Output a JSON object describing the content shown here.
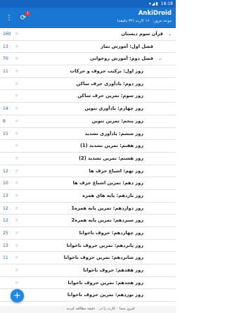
{
  "status": {
    "time": "18:18",
    "icons": "▾◢▮"
  },
  "appbar": {
    "title": "AnkiDroid",
    "subtitle": "موعد مرور: ۱۶۰ کارت (۳۲ دقیقه)",
    "sync_icon": "sync-icon",
    "sync_badge": "1",
    "more_icon": "more-vert-icon"
  },
  "decks": [
    {
      "name": "قرآن سوم دبستان",
      "count": "160",
      "count_color": "#1565c0",
      "level": 0,
      "expander": "⌄"
    },
    {
      "name": "فصل اول: آموزش نماز",
      "count": "13",
      "count_color": "#1565c0",
      "level": 1,
      "expander": ""
    },
    {
      "name": "فصل دوم: آموزش روخوانی",
      "count": "70",
      "count_color": "#1565c0",
      "level": 1,
      "expander": "⌄"
    },
    {
      "name": "روز اول: ترکیب حروف و حرکات",
      "count": "11",
      "count_color": "#1565c0",
      "level": 2,
      "expander": ""
    },
    {
      "name": "روز دوم: یادآوری حرف ساکن",
      "count": "",
      "count_color": "#1565c0",
      "level": 2,
      "expander": ""
    },
    {
      "name": "روز سوم: تمرین حرف ساکن",
      "count": "",
      "count_color": "#1565c0",
      "level": 2,
      "expander": ""
    },
    {
      "name": "روز چهارم: یادآوری تنوین",
      "count": "14",
      "count_color": "#1565c0",
      "level": 2,
      "expander": ""
    },
    {
      "name": "روز پنجم: تمرین تنوین",
      "count": "8",
      "count_color": "#1565c0",
      "level": 2,
      "expander": ""
    },
    {
      "name": "روز ششم: یادآوری تشدید",
      "count": "15",
      "count_color": "#1565c0",
      "level": 2,
      "expander": ""
    },
    {
      "name": "روز هفتم: تمرین تشدید (1)",
      "count": "",
      "count_color": "#1565c0",
      "level": 2,
      "expander": ""
    },
    {
      "name": "روز هشتم: تمرین تشدید (2)",
      "count": "",
      "count_color": "#1565c0",
      "level": 2,
      "expander": ""
    },
    {
      "name": "روز نهم: اشباع حرف ها",
      "count": "12",
      "count_color": "#1565c0",
      "level": 2,
      "expander": ""
    },
    {
      "name": "روز دهم: تمرین اشباع حرف ها",
      "count": "10",
      "count_color": "#1565c0",
      "level": 2,
      "expander": ""
    },
    {
      "name": "روز یازدهم: پایه های همزه",
      "count": "13",
      "count_color": "#1565c0",
      "level": 2,
      "expander": ""
    },
    {
      "name": "روز دوازدهم: تمرین پایه همزه1",
      "count": "12",
      "count_color": "#1565c0",
      "level": 2,
      "expander": ""
    },
    {
      "name": "روز سیزدهم: تمرین پایه همزه2",
      "count": "12",
      "count_color": "#1565c0",
      "level": 2,
      "expander": ""
    },
    {
      "name": "روز چهاردهم: حروف ناخوانا",
      "count": "25",
      "count_color": "#1565c0",
      "level": 2,
      "expander": ""
    },
    {
      "name": "روز پانزدهم: تمرین حروف ناخوانا",
      "count": "13",
      "count_color": "#1565c0",
      "level": 2,
      "expander": ""
    },
    {
      "name": "روز شانزدهم: تمرین حروف ناخوانا",
      "count": "11",
      "count_color": "#1565c0",
      "level": 2,
      "expander": ""
    },
    {
      "name": "روز هفدهم: حروف ناخوانا",
      "count": "",
      "count_color": "#1565c0",
      "level": 2,
      "expander": ""
    },
    {
      "name": "روز هجدهم: تمرین حروف ناخوانا",
      "count": "",
      "count_color": "#1565c0",
      "level": 2,
      "expander": ""
    },
    {
      "name": "روز نوزدهم: تمرین حروف ناخوانا",
      "count": "",
      "count_color": "#1565c0",
      "level": 2,
      "expander": ""
    }
  ],
  "gear_glyph": "☼",
  "fab": {
    "label": "+"
  },
  "footer": "امروز شما ۰ کارت را در ۰ دقیقه مطالعه کردید"
}
